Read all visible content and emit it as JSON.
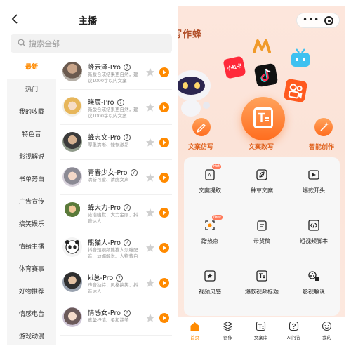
{
  "left": {
    "title": "主播",
    "search_placeholder": "搜索全部",
    "categories": [
      "最新",
      "热门",
      "我的收藏",
      "特色音",
      "影视解说",
      "书单旁白",
      "广告宣传",
      "搞笑娱乐",
      "情绪主播",
      "体育赛事",
      "好物推荐",
      "情感电台",
      "游戏动漫"
    ],
    "voices": [
      {
        "name": "蜂云泽-Pro",
        "desc": "新版合成结果更自然，建议1000字以内文案"
      },
      {
        "name": "晓辰-Pro",
        "desc": "新版合成结果更自然，建议1000字以内文案"
      },
      {
        "name": "蜂志文-Pro",
        "desc": "厚重清晰、慷慨激昂"
      },
      {
        "name": "青春少女-Pro",
        "desc": "清新可爱、清脆女声"
      },
      {
        "name": "蜂大力-Pro",
        "desc": "诙谐幽默、大力金刚、抖音达人"
      },
      {
        "name": "熊猫人-Pro",
        "desc": "抖音短视频熊猫人沙雕配音、幼媚解说、人物背白"
      },
      {
        "name": "ki总-Pro",
        "desc": "声音独特、风格搞笑、抖音达人"
      },
      {
        "name": "情感女-Pro",
        "desc": "真挚抒情、柔和甜美"
      }
    ],
    "colors": {
      "accent": "#ff8a00",
      "sidebar_bg": "#f5f5f5"
    }
  },
  "right": {
    "app_title": "写作蜂",
    "menu_dots": "•••",
    "primary": {
      "left": "文案仿写",
      "center": "文案改写",
      "right": "智能创作",
      "center_glyph": "T≡"
    },
    "floating_labels": [
      "小红书"
    ],
    "tools": [
      {
        "label": "文案提取",
        "badge": "Hot",
        "icon": "doc-extract-icon"
      },
      {
        "label": "种草文案",
        "badge": "",
        "icon": "leaf-icon"
      },
      {
        "label": "爆款开头",
        "badge": "",
        "icon": "video-icon"
      },
      {
        "label": "蹭热点",
        "badge": "New",
        "icon": "hotspot-icon"
      },
      {
        "label": "带货稿",
        "badge": "",
        "icon": "clipboard-icon"
      },
      {
        "label": "短视频脚本",
        "badge": "",
        "icon": "code-icon"
      },
      {
        "label": "视频灵感",
        "badge": "",
        "icon": "star-box-icon"
      },
      {
        "label": "爆款视频标题",
        "badge": "",
        "icon": "title-icon"
      },
      {
        "label": "影视解说",
        "badge": "",
        "icon": "film-icon"
      }
    ],
    "tabs": [
      {
        "label": "首页",
        "icon": "home-icon",
        "active": true
      },
      {
        "label": "创作",
        "icon": "layers-icon",
        "active": false
      },
      {
        "label": "文案库",
        "icon": "library-icon",
        "active": false
      },
      {
        "label": "AI问答",
        "icon": "question-icon",
        "active": false
      },
      {
        "label": "我的",
        "icon": "profile-icon",
        "active": false
      }
    ],
    "colors": {
      "accent": "#ff7a1a",
      "bg": "#fde6dc"
    }
  }
}
